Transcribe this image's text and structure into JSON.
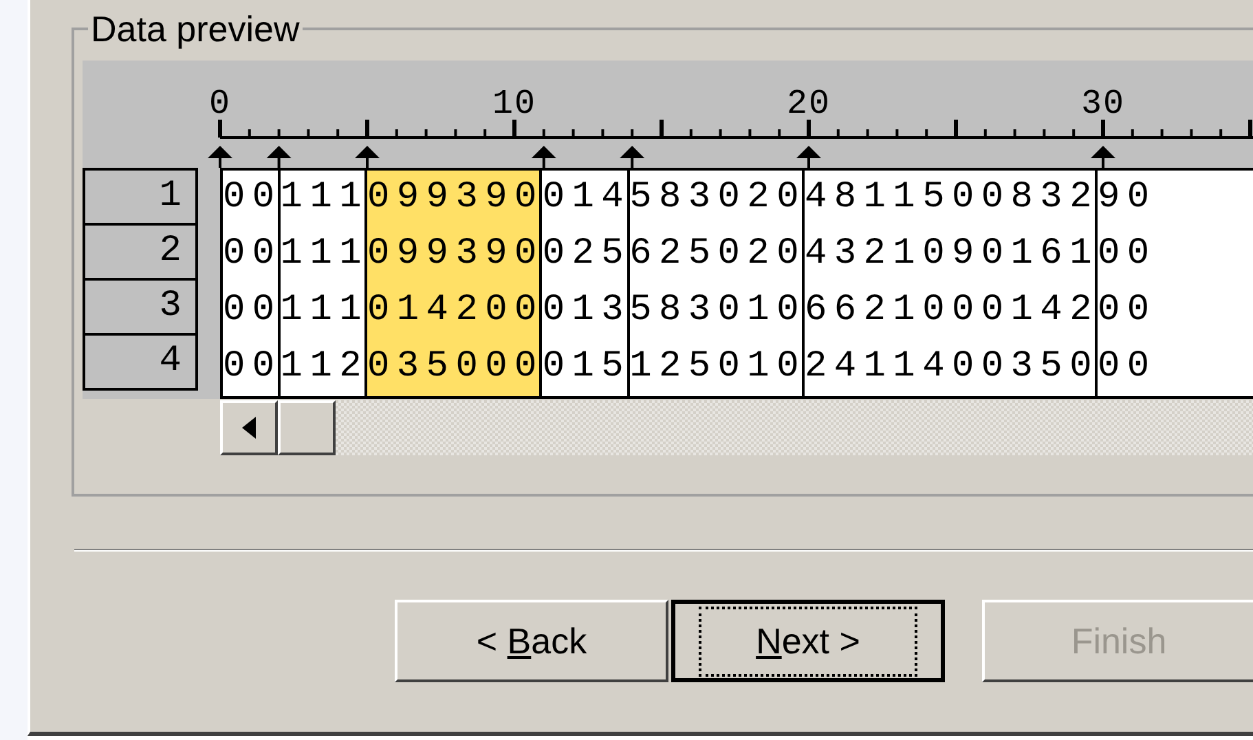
{
  "group_title": "Data preview",
  "ruler_labels": [
    "0",
    "10",
    "20",
    "30"
  ],
  "columns": [
    {
      "selected": false
    },
    {
      "selected": false
    },
    {
      "selected": true
    },
    {
      "selected": false
    },
    {
      "selected": false
    },
    {
      "selected": false
    },
    {
      "selected": false
    }
  ],
  "rows": [
    {
      "number": "1",
      "cells": [
        "00",
        "111",
        "099390",
        "014",
        "583020",
        "4811500832",
        "90"
      ]
    },
    {
      "number": "2",
      "cells": [
        "00",
        "111",
        "099390",
        "025",
        "625020",
        "4321090161",
        "00"
      ]
    },
    {
      "number": "3",
      "cells": [
        "00",
        "111",
        "014200",
        "013",
        "583010",
        "6621000142",
        "00"
      ]
    },
    {
      "number": "4",
      "cells": [
        "00",
        "112",
        "035000",
        "015",
        "125010",
        "2411400350",
        "00"
      ]
    }
  ],
  "buttons": [
    {
      "before": "< ",
      "mnemonic": "B",
      "after": "ack",
      "default": false,
      "disabled": false
    },
    {
      "mnemonic": "N",
      "after": "ext >",
      "default": true,
      "disabled": false
    },
    {
      "after": "Finish",
      "default": false,
      "disabled": true
    }
  ]
}
